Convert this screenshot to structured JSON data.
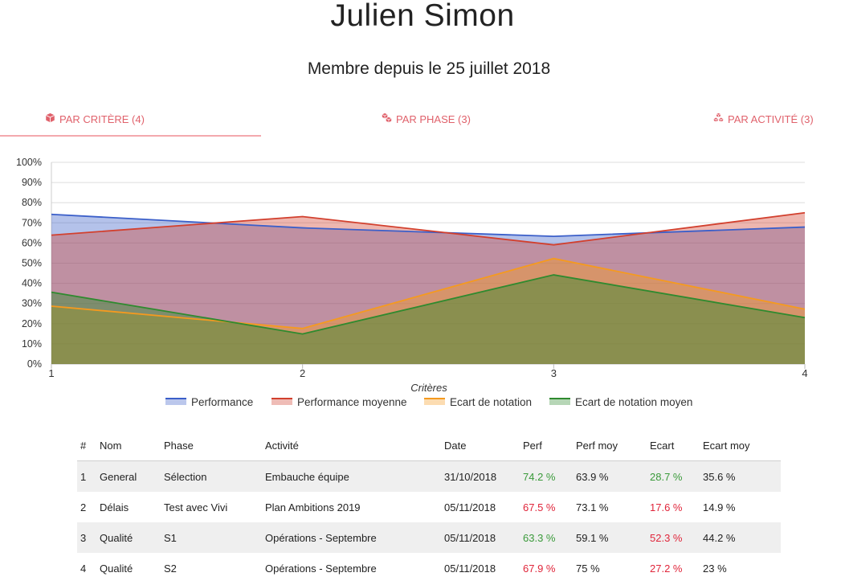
{
  "header": {
    "name": "Julien Simon",
    "member_since": "Membre depuis le 25 juillet 2018"
  },
  "tabs": [
    {
      "label": "PAR CRITÈRE (4)",
      "icon": "cube-icon",
      "active": true
    },
    {
      "label": "PAR PHASE (3)",
      "icon": "cubes-icon",
      "active": false
    },
    {
      "label": "PAR ACTIVITÉ (3)",
      "icon": "cubes-stack-icon",
      "active": false
    }
  ],
  "colors": {
    "accent": "#e0616b",
    "performance": "#3b5fc9",
    "performance_moyenne": "#d2402e",
    "ecart": "#f59a1f",
    "ecart_moyen": "#2f8a2f",
    "good": "#3a9a3a",
    "bad": "#e0263b"
  },
  "chart_data": {
    "type": "area",
    "x": [
      1,
      2,
      3,
      4
    ],
    "xlabel": "Critères",
    "ylabel": "",
    "ylim": [
      0,
      100
    ],
    "y_ticks": [
      "0%",
      "10%",
      "20%",
      "30%",
      "40%",
      "50%",
      "60%",
      "70%",
      "80%",
      "90%",
      "100%"
    ],
    "x_ticks": [
      "1",
      "2",
      "3",
      "4"
    ],
    "grid": true,
    "legend_position": "bottom",
    "series": [
      {
        "name": "Performance",
        "values": [
          74.2,
          67.5,
          63.3,
          67.9
        ],
        "color": "#3b5fc9"
      },
      {
        "name": "Performance moyenne",
        "values": [
          63.9,
          73.1,
          59.1,
          75
        ],
        "color": "#d2402e"
      },
      {
        "name": "Ecart de notation",
        "values": [
          28.7,
          17.6,
          52.3,
          27.2
        ],
        "color": "#f59a1f"
      },
      {
        "name": "Ecart de notation moyen",
        "values": [
          35.6,
          14.9,
          44.2,
          23
        ],
        "color": "#2f8a2f"
      }
    ]
  },
  "table": {
    "headers": [
      "#",
      "Nom",
      "Phase",
      "Activité",
      "Date",
      "Perf",
      "Perf moy",
      "Ecart",
      "Ecart moy"
    ],
    "rows": [
      {
        "num": "1",
        "nom": "General",
        "phase": "Sélection",
        "activite": "Embauche équipe",
        "date": "31/10/2018",
        "perf": "74.2 %",
        "perf_status": "good",
        "perf_moy": "63.9 %",
        "ecart": "28.7 %",
        "ecart_status": "good",
        "ecart_moy": "35.6 %"
      },
      {
        "num": "2",
        "nom": "Délais",
        "phase": "Test avec Vivi",
        "activite": "Plan Ambitions 2019",
        "date": "05/11/2018",
        "perf": "67.5 %",
        "perf_status": "bad",
        "perf_moy": "73.1 %",
        "ecart": "17.6 %",
        "ecart_status": "bad",
        "ecart_moy": "14.9 %"
      },
      {
        "num": "3",
        "nom": "Qualité",
        "phase": "S1",
        "activite": "Opérations - Septembre",
        "date": "05/11/2018",
        "perf": "63.3 %",
        "perf_status": "good",
        "perf_moy": "59.1 %",
        "ecart": "52.3 %",
        "ecart_status": "bad",
        "ecart_moy": "44.2 %"
      },
      {
        "num": "4",
        "nom": "Qualité",
        "phase": "S2",
        "activite": "Opérations - Septembre",
        "date": "05/11/2018",
        "perf": "67.9 %",
        "perf_status": "bad",
        "perf_moy": "75 %",
        "ecart": "27.2 %",
        "ecart_status": "bad",
        "ecart_moy": "23 %"
      }
    ]
  }
}
